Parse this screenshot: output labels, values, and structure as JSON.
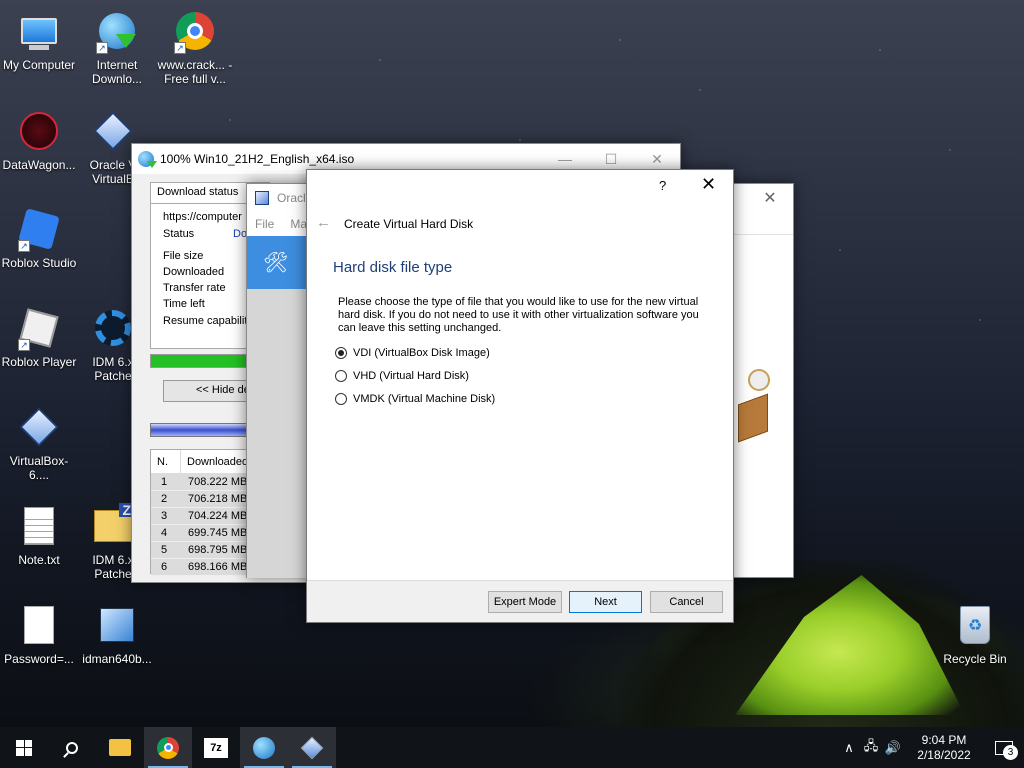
{
  "desktop": {
    "icons": [
      {
        "label": "My Computer"
      },
      {
        "label": "Internet Downlo..."
      },
      {
        "label": "www.crack... - Free full v..."
      },
      {
        "label": "DataWagon..."
      },
      {
        "label": "Oracle V VirtualB"
      },
      {
        "label": "Roblox Studio"
      },
      {
        "label": "Roblox Player"
      },
      {
        "label": "IDM 6.x Patche"
      },
      {
        "label": "VirtualBox-6...."
      },
      {
        "label": "Note.txt"
      },
      {
        "label": "IDM 6.x Patche"
      },
      {
        "label": "Password=..."
      },
      {
        "label": "idman640b..."
      },
      {
        "label": "Recycle Bin"
      }
    ]
  },
  "idm_window": {
    "title": "100% Win10_21H2_English_x64.iso",
    "tab_label": "Download status",
    "url": "https://computer",
    "status_label": "Status",
    "status_value": "Do",
    "fields": [
      "File size",
      "Downloaded",
      "Transfer rate",
      "Time left",
      "Resume capability"
    ],
    "hide_button": "<< Hide de",
    "table": {
      "headers": [
        "N.",
        "Downloaded"
      ],
      "rows": [
        [
          "1",
          "708.222  MB"
        ],
        [
          "2",
          "706.218  MB"
        ],
        [
          "3",
          "704.224  MB"
        ],
        [
          "4",
          "699.745  MB"
        ],
        [
          "5",
          "698.795  MB"
        ],
        [
          "6",
          "698.166  MB"
        ]
      ]
    }
  },
  "vbox_manager": {
    "title": "Oracle",
    "menu": [
      "File",
      "Ma"
    ]
  },
  "wizard": {
    "help": "?",
    "close": "✕",
    "back": "←",
    "caption": "Create Virtual Hard Disk",
    "heading": "Hard disk file type",
    "description": "Please choose the type of file that you would like to use for the new virtual hard disk. If you do not need to use it with other virtualization software you can leave this setting unchanged.",
    "options": [
      {
        "label": "VDI (VirtualBox Disk Image)",
        "selected": true
      },
      {
        "label": "VHD (Virtual Hard Disk)",
        "selected": false
      },
      {
        "label": "VMDK (Virtual Machine Disk)",
        "selected": false
      }
    ],
    "buttons": {
      "expert": "Expert Mode",
      "next": "Next",
      "cancel": "Cancel"
    }
  },
  "taskbar": {
    "time": "9:04 PM",
    "date": "2/18/2022",
    "notification_count": "3",
    "tray_chevron": "∧",
    "tray_network": "🖧",
    "tray_volume": "🔊"
  },
  "colors": {
    "accent": "#0078d7",
    "wizard_heading": "#1e3f79",
    "idm_progress": "#25c025",
    "vbox_tools": "#3d8ee0"
  }
}
